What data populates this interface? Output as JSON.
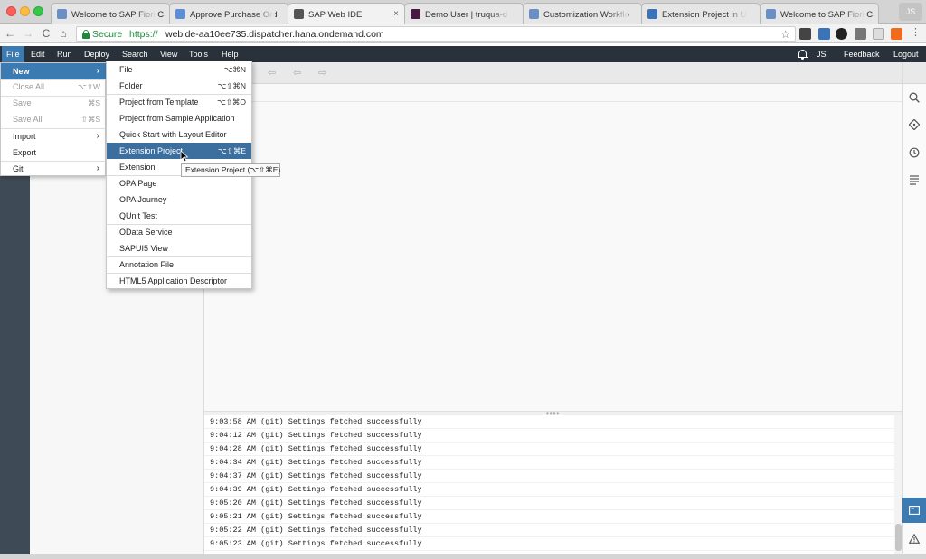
{
  "browser": {
    "tabs": [
      {
        "title": "Welcome to SAP Fiori C",
        "favicon_color": "#6a8fc7",
        "active": false
      },
      {
        "title": "Approve Purchase Ord",
        "favicon_color": "#5c8ed6",
        "active": false
      },
      {
        "title": "SAP Web IDE",
        "favicon_color": "#555555",
        "active": true,
        "close": "×"
      },
      {
        "title": "Demo User | truqua-d",
        "favicon_color": "#4a1942",
        "active": false
      },
      {
        "title": "Customization Workflo",
        "favicon_color": "#6a8fc7",
        "active": false
      },
      {
        "title": "Extension Project in U",
        "favicon_color": "#3b73b9",
        "active": false
      },
      {
        "title": "Welcome to SAP Fiori C",
        "favicon_color": "#6a8fc7",
        "active": false
      }
    ],
    "profile_initials": "JS",
    "secure_label": "Secure",
    "url_protocol": "https://",
    "url_host": "webide-aa10ee735.dispatcher.hana.ondemand.com",
    "nav": {
      "back": "←",
      "forward": "→",
      "reload": "C",
      "home": "⌂"
    },
    "star": "☆"
  },
  "menubar": {
    "items": [
      "File",
      "Edit",
      "Run",
      "Deploy",
      "Search",
      "View",
      "Tools",
      "Help"
    ],
    "active": "File",
    "user_initials": "JS",
    "feedback": "Feedback",
    "logout": "Logout"
  },
  "file_menu": {
    "items": [
      {
        "label": "New",
        "shortcut": "",
        "submenu_arrow": "›",
        "state": "active"
      },
      {
        "label": "Close All",
        "shortcut": "⌥⇧W",
        "state": "disabled"
      },
      {
        "label": "Save",
        "shortcut": "⌘S",
        "state": "disabled"
      },
      {
        "label": "Save All",
        "shortcut": "⇧⌘S",
        "state": "disabled"
      },
      {
        "label": "Import",
        "submenu_arrow": "›",
        "state": "normal"
      },
      {
        "label": "Export",
        "state": "normal"
      },
      {
        "label": "Git",
        "submenu_arrow": "›",
        "state": "normal"
      }
    ]
  },
  "new_submenu": {
    "items": [
      {
        "label": "File",
        "shortcut": "⌥⌘N"
      },
      {
        "label": "Folder",
        "shortcut": "⌥⇧⌘N"
      },
      {
        "label": "Project from Template",
        "shortcut": "⌥⇧⌘O"
      },
      {
        "label": "Project from Sample Application",
        "shortcut": ""
      },
      {
        "label": "Quick Start with Layout Editor",
        "shortcut": ""
      },
      {
        "label": "Extension Project",
        "shortcut": "⌥⇧⌘E",
        "active": true
      },
      {
        "label": "Extension",
        "shortcut": ""
      },
      {
        "label": "OPA Page",
        "shortcut": ""
      },
      {
        "label": "OPA Journey",
        "shortcut": ""
      },
      {
        "label": "QUnit Test",
        "shortcut": ""
      },
      {
        "label": "OData Service",
        "shortcut": ""
      },
      {
        "label": "SAPUI5 View",
        "shortcut": ""
      },
      {
        "label": "Annotation File",
        "shortcut": ""
      },
      {
        "label": "HTML5 Application Descriptor",
        "shortcut": ""
      }
    ]
  },
  "tooltip": "Extension Project (⌥⇧⌘E)",
  "console": {
    "lines": [
      "9:03:58 AM (git) Settings fetched successfully",
      "9:04:12 AM (git) Settings fetched successfully",
      "9:04:28 AM (git) Settings fetched successfully",
      "9:04:34 AM (git) Settings fetched successfully",
      "9:04:37 AM (git) Settings fetched successfully",
      "9:04:39 AM (git) Settings fetched successfully",
      "9:05:20 AM (git) Settings fetched successfully",
      "9:05:21 AM (git) Settings fetched successfully",
      "9:05:22 AM (git) Settings fetched successfully",
      "9:05:23 AM (git) Settings fetched successfully"
    ]
  },
  "right_rail_icons": [
    "search-icon",
    "git-icon",
    "history-icon",
    "outline-icon",
    "console-icon",
    "warning-icon"
  ],
  "colors": {
    "accent": "#3c7ab2",
    "menubar": "#29313a",
    "secure": "#1a8a3a"
  }
}
